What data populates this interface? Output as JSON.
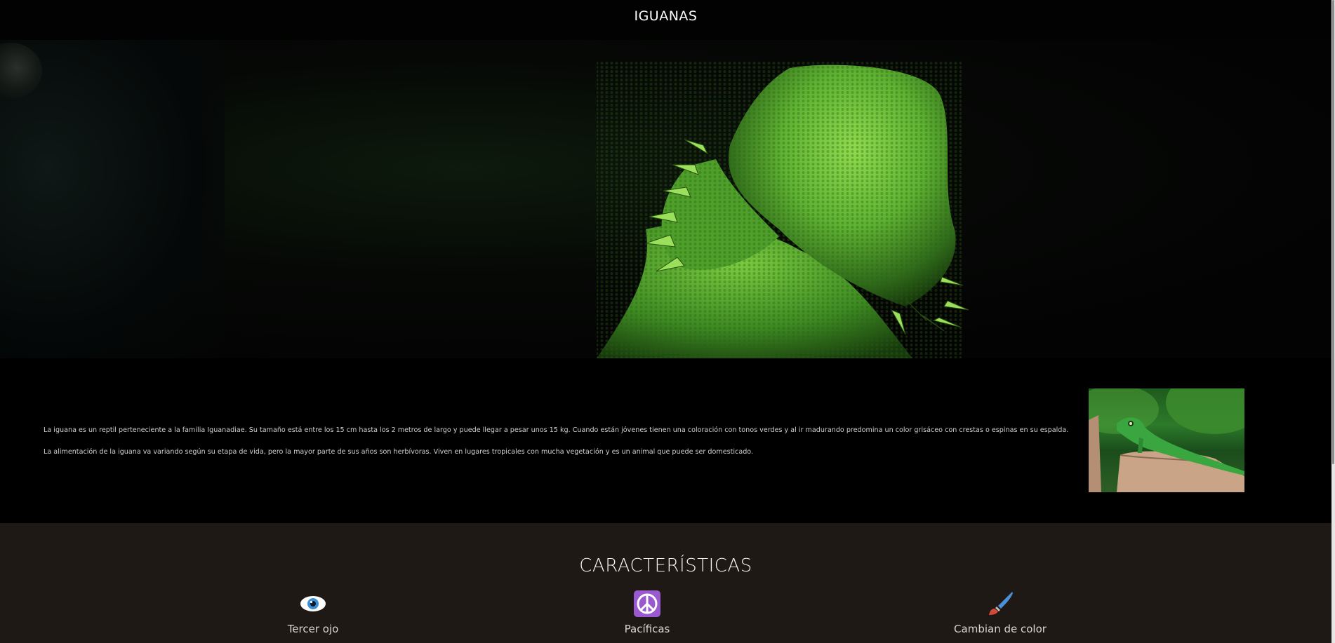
{
  "header": {
    "title": "IGUANAS"
  },
  "hero": {
    "alt": "iguana close-up"
  },
  "intro": {
    "paragraphs": [
      "La iguana es un reptil perteneciente a la familia Iguanadiae. Su tamaño está entre los 15 cm hasta los 2 metros de largo y puede llegar a pesar unos 15 kg. Cuando están jóvenes tienen una coloración con tonos verdes y al ir madurando predomina un color grisáceo con crestas o espinas en su espalda.",
      "La alimentación de la iguana va variando según su etapa de vida, pero la mayor parte de sus años son herbívoras. Viven en lugares tropicales con mucha vegetación y es un animal que puede ser domesticado."
    ],
    "photo_alt": "green iguana on a tree stump"
  },
  "features": {
    "heading": "CARACTERÍSTICAS",
    "items": [
      {
        "icon": "eye-icon",
        "label": "Tercer ojo"
      },
      {
        "icon": "peace-icon",
        "label": "Pacíficas"
      },
      {
        "icon": "paintbrush-icon",
        "label": "Cambian de color"
      }
    ]
  },
  "colors": {
    "header_bg": "#020202",
    "intro_bg": "#000000",
    "features_bg": "#1e1914",
    "iguana_green": "#6cc43a",
    "peace_purple": "#9b59d0"
  }
}
